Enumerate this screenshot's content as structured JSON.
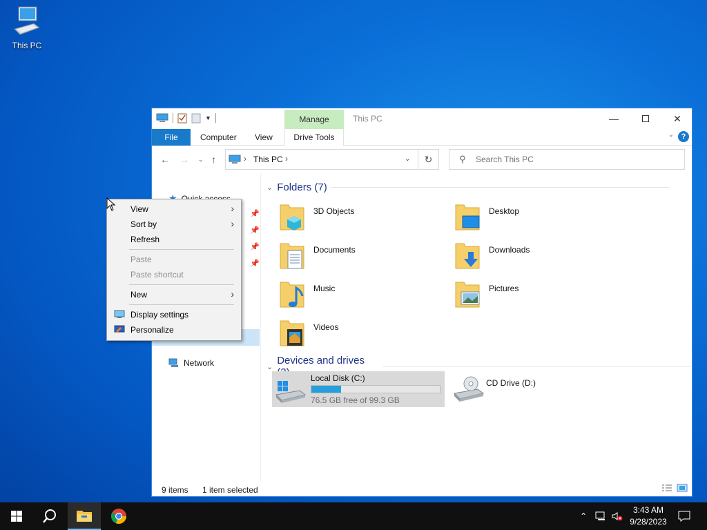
{
  "desktop": {
    "icon_label": "This PC"
  },
  "window": {
    "title": "This PC",
    "contextual_tab": "Manage",
    "ribbon_tabs": {
      "file": "File",
      "computer": "Computer",
      "view": "View",
      "drive_tools": "Drive Tools"
    },
    "help": "?",
    "address": {
      "location": "This PC"
    },
    "search": {
      "placeholder": "Search This PC"
    },
    "nav": {
      "quick_access": "Quick access",
      "network": "Network"
    },
    "groups": {
      "folders": "Folders (7)",
      "devices": "Devices and drives (2)"
    },
    "folders": [
      {
        "name": "3D Objects",
        "icon": "3d-objects-icon"
      },
      {
        "name": "Desktop",
        "icon": "desktop-folder-icon"
      },
      {
        "name": "Documents",
        "icon": "documents-icon"
      },
      {
        "name": "Downloads",
        "icon": "downloads-icon"
      },
      {
        "name": "Music",
        "icon": "music-icon"
      },
      {
        "name": "Pictures",
        "icon": "pictures-icon"
      },
      {
        "name": "Videos",
        "icon": "videos-icon"
      }
    ],
    "drives": [
      {
        "name": "Local Disk (C:)",
        "free_text": "76.5 GB free of 99.3 GB",
        "used_fraction": 0.23
      },
      {
        "name": "CD Drive (D:)"
      }
    ],
    "status": {
      "items": "9 items",
      "selected": "1 item selected"
    }
  },
  "context_menu": {
    "view": "View",
    "sort_by": "Sort by",
    "refresh": "Refresh",
    "paste": "Paste",
    "paste_shortcut": "Paste shortcut",
    "new": "New",
    "display_settings": "Display settings",
    "personalize": "Personalize"
  },
  "taskbar": {
    "time": "3:43 AM",
    "date": "9/28/2023"
  },
  "colors": {
    "accent": "#1979ca",
    "manage_tab": "#c7ecbf",
    "drive_bar": "#26a0da",
    "selection": "#cce4f7"
  }
}
